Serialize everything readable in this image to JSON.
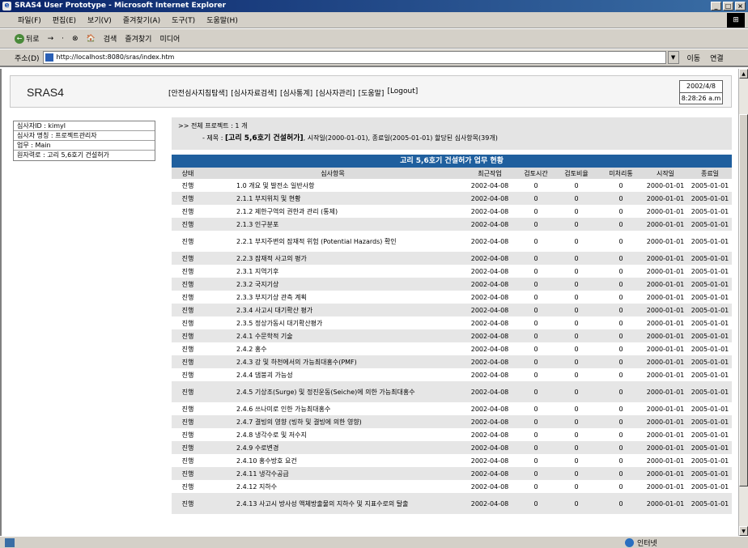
{
  "window": {
    "title": "SRAS4 User Prototype - Microsoft Internet Explorer",
    "controls": [
      "_",
      "□",
      "×"
    ]
  },
  "menu": [
    "파일(F)",
    "편집(E)",
    "보기(V)",
    "즐겨찾기(A)",
    "도구(T)",
    "도움말(H)"
  ],
  "toolbar": [
    "뒤로",
    "→",
    "·",
    "⊗",
    "🏠",
    "검색",
    "즐겨찾기",
    "미디어"
  ],
  "address": {
    "label": "주소(D)",
    "url": "http://localhost:8080/sras/index.htm",
    "go": "이동",
    "links": "연결"
  },
  "app": {
    "title": "SRAS4",
    "nav": [
      "[안전심사지침탐색]",
      "[심사자료검색]",
      "[심사통계]",
      "[심사자관리]",
      "[도움말]",
      "[Logout]"
    ],
    "date": "2002/4/8",
    "time": "8:28:26 a.m"
  },
  "info": [
    "심사자ID : kimyl",
    "심사자 명칭 : 프로젝트관리자",
    "업무 : Main",
    "원자력로 : 고리 5,6호기 건설허가"
  ],
  "summary": {
    "line1": ">> 전체 프로젝트 : 1 개",
    "line2_prefix": "- 제목 : ",
    "line2_bold": "[고리 5,6호기 건설허가]",
    "line2_suffix": ", 시작일(2000-01-01), 종료일(2005-01-01) 할당된 심사항목(39개)"
  },
  "table": {
    "title": "고리 5,6호기 건설허가 업무 현황",
    "headers": [
      "상태",
      "심사항목",
      "최근작업",
      "검토시간",
      "검토비율",
      "미처리통",
      "시작일",
      "종료일"
    ],
    "rows": [
      {
        "status": "진행",
        "item": "1.0 개요 및 발전소 일반사항",
        "recent": "2002-04-08",
        "time": "0",
        "ratio": "0",
        "pending": "0",
        "start": "2000-01-01",
        "end": "2005-01-01"
      },
      {
        "status": "진행",
        "item": "2.1.1 부지위치 및 현황",
        "recent": "2002-04-08",
        "time": "0",
        "ratio": "0",
        "pending": "0",
        "start": "2000-01-01",
        "end": "2005-01-01"
      },
      {
        "status": "진행",
        "item": "2.1.2 제한구역의 권한과 관리 (통제)",
        "recent": "2002-04-08",
        "time": "0",
        "ratio": "0",
        "pending": "0",
        "start": "2000-01-01",
        "end": "2005-01-01"
      },
      {
        "status": "진행",
        "item": "2.1.3 인구분포",
        "recent": "2002-04-08",
        "time": "0",
        "ratio": "0",
        "pending": "0",
        "start": "2000-01-01",
        "end": "2005-01-01"
      },
      {
        "status": "진행",
        "item": "2.2.1 부지주변의 잠재적 위험 (Potential Hazards) 확인",
        "recent": "2002-04-08",
        "time": "0",
        "ratio": "0",
        "pending": "0",
        "start": "2000-01-01",
        "end": "2005-01-01",
        "tall": true
      },
      {
        "status": "진행",
        "item": "2.2.3 잠재적 사고의 평가",
        "recent": "2002-04-08",
        "time": "0",
        "ratio": "0",
        "pending": "0",
        "start": "2000-01-01",
        "end": "2005-01-01"
      },
      {
        "status": "진행",
        "item": "2.3.1 지역기후",
        "recent": "2002-04-08",
        "time": "0",
        "ratio": "0",
        "pending": "0",
        "start": "2000-01-01",
        "end": "2005-01-01"
      },
      {
        "status": "진행",
        "item": "2.3.2 국지기상",
        "recent": "2002-04-08",
        "time": "0",
        "ratio": "0",
        "pending": "0",
        "start": "2000-01-01",
        "end": "2005-01-01"
      },
      {
        "status": "진행",
        "item": "2.3.3 부지기상 관측 계획",
        "recent": "2002-04-08",
        "time": "0",
        "ratio": "0",
        "pending": "0",
        "start": "2000-01-01",
        "end": "2005-01-01"
      },
      {
        "status": "진행",
        "item": "2.3.4 사고시 대기확산 평가",
        "recent": "2002-04-08",
        "time": "0",
        "ratio": "0",
        "pending": "0",
        "start": "2000-01-01",
        "end": "2005-01-01"
      },
      {
        "status": "진행",
        "item": "2.3.5 정상가동시 대기확산평가",
        "recent": "2002-04-08",
        "time": "0",
        "ratio": "0",
        "pending": "0",
        "start": "2000-01-01",
        "end": "2005-01-01"
      },
      {
        "status": "진행",
        "item": "2.4.1 수문학적 기술",
        "recent": "2002-04-08",
        "time": "0",
        "ratio": "0",
        "pending": "0",
        "start": "2000-01-01",
        "end": "2005-01-01"
      },
      {
        "status": "진행",
        "item": "2.4.2 홍수",
        "recent": "2002-04-08",
        "time": "0",
        "ratio": "0",
        "pending": "0",
        "start": "2000-01-01",
        "end": "2005-01-01"
      },
      {
        "status": "진행",
        "item": "2.4.3 강 및 하천에서의 가능최대홍수(PMF)",
        "recent": "2002-04-08",
        "time": "0",
        "ratio": "0",
        "pending": "0",
        "start": "2000-01-01",
        "end": "2005-01-01"
      },
      {
        "status": "진행",
        "item": "2.4.4 댐붕괴 가능성",
        "recent": "2002-04-08",
        "time": "0",
        "ratio": "0",
        "pending": "0",
        "start": "2000-01-01",
        "end": "2005-01-01"
      },
      {
        "status": "진행",
        "item": "2.4.5 기상조(Surge) 및 정진운동(Seiche)에 의한 가능최대홍수",
        "recent": "2002-04-08",
        "time": "0",
        "ratio": "0",
        "pending": "0",
        "start": "2000-01-01",
        "end": "2005-01-01",
        "tall": true
      },
      {
        "status": "진행",
        "item": "2.4.6 쓰나미로 인한 가능최대홍수",
        "recent": "2002-04-08",
        "time": "0",
        "ratio": "0",
        "pending": "0",
        "start": "2000-01-01",
        "end": "2005-01-01"
      },
      {
        "status": "진행",
        "item": "2.4.7 결빙의 영향 (빙하 및 결빙에 의한 영향)",
        "recent": "2002-04-08",
        "time": "0",
        "ratio": "0",
        "pending": "0",
        "start": "2000-01-01",
        "end": "2005-01-01"
      },
      {
        "status": "진행",
        "item": "2.4.8 냉각수로 및 저수지",
        "recent": "2002-04-08",
        "time": "0",
        "ratio": "0",
        "pending": "0",
        "start": "2000-01-01",
        "end": "2005-01-01"
      },
      {
        "status": "진행",
        "item": "2.4.9 수로변경",
        "recent": "2002-04-08",
        "time": "0",
        "ratio": "0",
        "pending": "0",
        "start": "2000-01-01",
        "end": "2005-01-01"
      },
      {
        "status": "진행",
        "item": "2.4.10 홍수방호 요건",
        "recent": "2002-04-08",
        "time": "0",
        "ratio": "0",
        "pending": "0",
        "start": "2000-01-01",
        "end": "2005-01-01"
      },
      {
        "status": "진행",
        "item": "2.4.11 냉각수공급",
        "recent": "2002-04-08",
        "time": "0",
        "ratio": "0",
        "pending": "0",
        "start": "2000-01-01",
        "end": "2005-01-01"
      },
      {
        "status": "진행",
        "item": "2.4.12 지하수",
        "recent": "2002-04-08",
        "time": "0",
        "ratio": "0",
        "pending": "0",
        "start": "2000-01-01",
        "end": "2005-01-01"
      },
      {
        "status": "진행",
        "item": "2.4.13 사고시 방사성 액체방출물의 지하수 및 지표수로의 탈출",
        "recent": "2002-04-08",
        "time": "0",
        "ratio": "0",
        "pending": "0",
        "start": "2000-01-01",
        "end": "2005-01-01",
        "tall": true
      }
    ]
  },
  "status": {
    "zone": "인터넷"
  }
}
